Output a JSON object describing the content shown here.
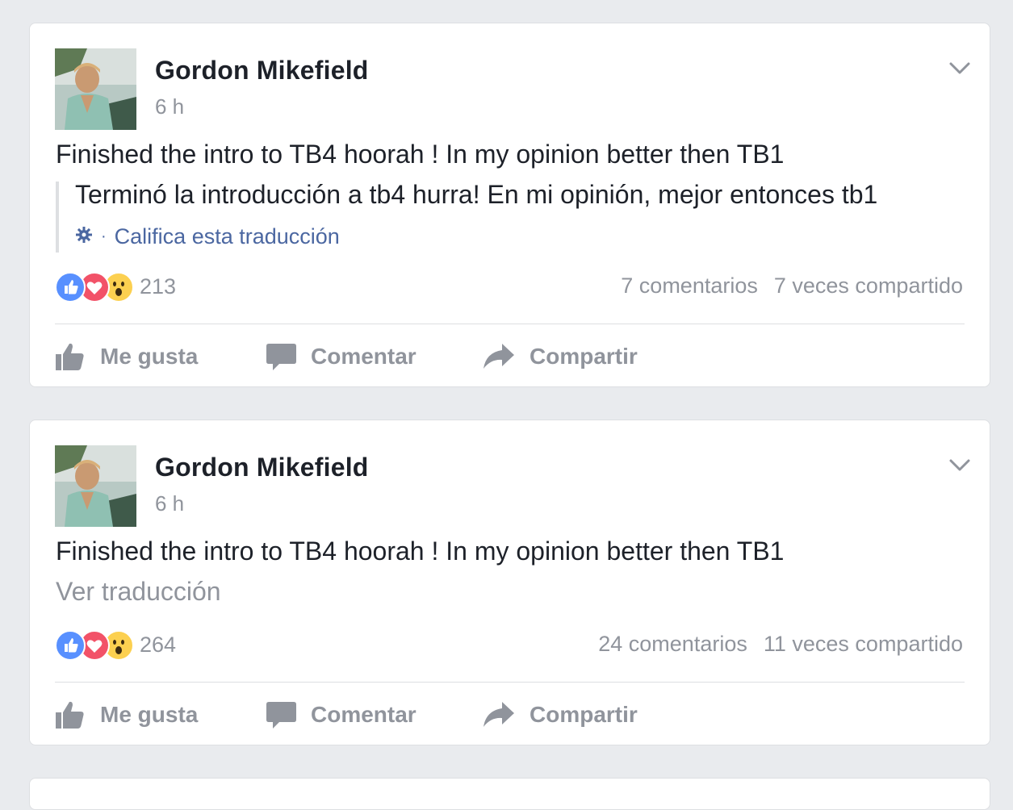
{
  "posts": [
    {
      "author": "Gordon Mikefield",
      "time": "6 h",
      "text": "Finished the intro to TB4 hoorah ! In my opinion better then TB1",
      "translation": "Terminó la introducción a tb4 hurra! En mi opinión, mejor entonces tb1",
      "rate_translation": "Califica esta traducción",
      "rate_separator": "·",
      "reaction_count": "213",
      "comments": "7 comentarios",
      "shares": "7 veces compartido",
      "actions": {
        "like": "Me gusta",
        "comment": "Comentar",
        "share": "Compartir"
      }
    },
    {
      "author": "Gordon Mikefield",
      "time": "6 h",
      "text": "Finished the intro to TB4 hoorah ! In my opinion better then TB1",
      "see_translation": "Ver traducción",
      "reaction_count": "264",
      "comments": "24 comentarios",
      "shares": "11 veces compartido",
      "actions": {
        "like": "Me gusta",
        "comment": "Comentar",
        "share": "Compartir"
      }
    }
  ],
  "icons": {
    "like_reaction": "thumbs-up-icon",
    "love_reaction": "heart-icon",
    "wow_reaction": "wow-face-icon",
    "gear": "gear-icon",
    "chevron": "chevron-down-icon",
    "like_action": "thumbs-up-icon",
    "comment_action": "speech-bubble-icon",
    "share_action": "share-arrow-icon"
  },
  "colors": {
    "link_blue": "#4b67a1",
    "like_blue": "#5890ff",
    "love_red": "#f25268",
    "wow_yellow": "#fcd050",
    "muted_text": "#90949c"
  }
}
